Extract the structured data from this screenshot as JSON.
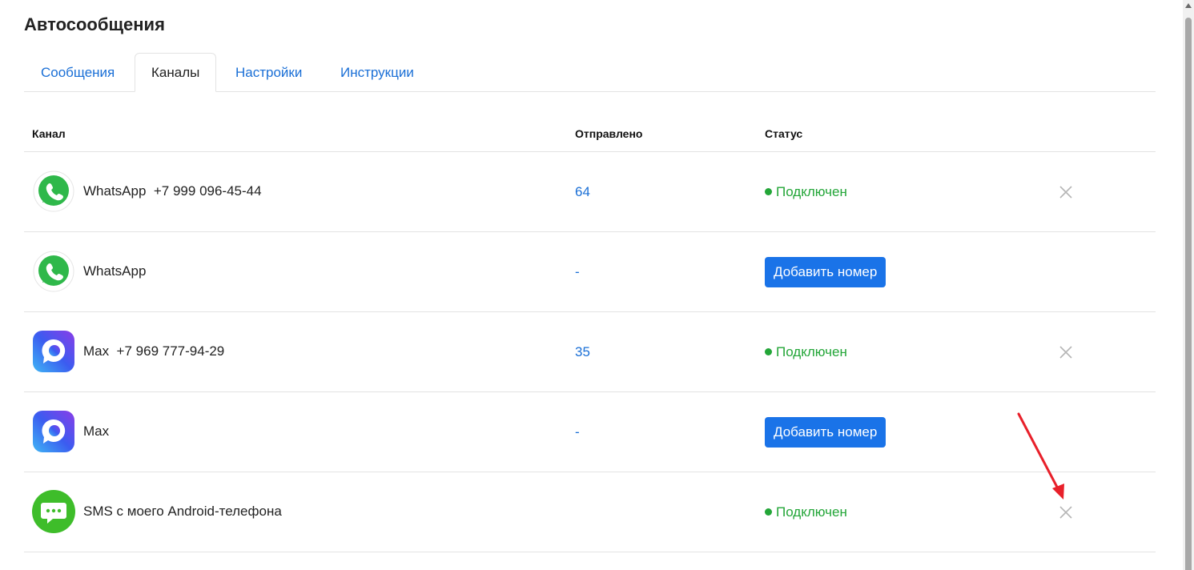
{
  "page": {
    "title": "Автосообщения"
  },
  "tabs": [
    {
      "label": "Сообщения",
      "active": false
    },
    {
      "label": "Каналы",
      "active": true
    },
    {
      "label": "Настройки",
      "active": false
    },
    {
      "label": "Инструкции",
      "active": false
    }
  ],
  "table": {
    "columns": [
      "Канал",
      "Отправлено",
      "Статус"
    ],
    "rows": [
      {
        "icon": "whatsapp-icon",
        "name": "WhatsApp  +7 999 096-45-44",
        "sent": "64",
        "status": "Подключен",
        "removable": true
      },
      {
        "icon": "whatsapp-icon",
        "name": "WhatsApp",
        "sent": "-",
        "button": "Добавить номер",
        "removable": false
      },
      {
        "icon": "max-icon",
        "name": "Max  +7 969 777-94-29",
        "sent": "35",
        "status": "Подключен",
        "removable": true
      },
      {
        "icon": "max-icon",
        "name": "Max",
        "sent": "-",
        "button": "Добавить номер",
        "removable": false
      },
      {
        "icon": "sms-android-icon",
        "name": "SMS с моего Android-телефона",
        "sent": "",
        "status": "Подключен",
        "removable": true
      }
    ]
  },
  "colors": {
    "link": "#1a6fd6",
    "connected": "#23a638",
    "button": "#1a73e8",
    "annotation_arrow": "#e8202a"
  }
}
